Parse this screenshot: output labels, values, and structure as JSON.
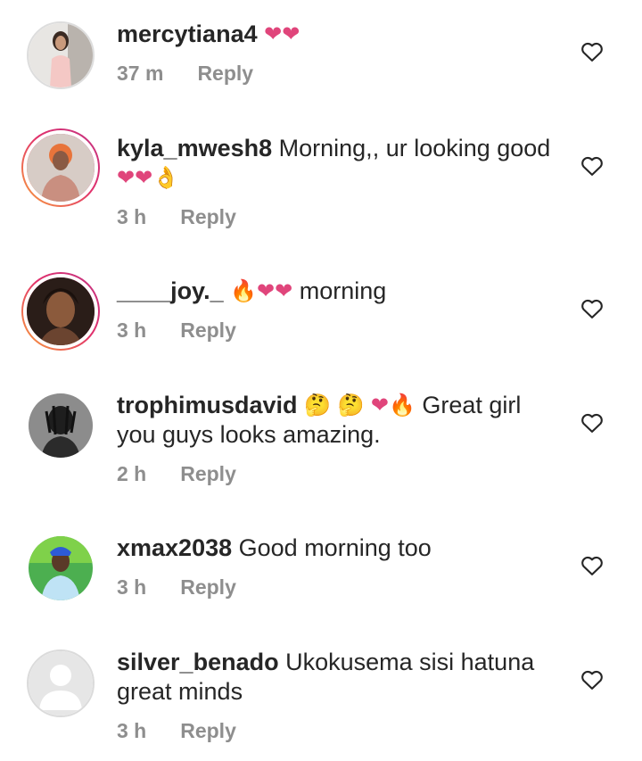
{
  "comments": [
    {
      "username": "mercytiana4",
      "text": "",
      "emoji_before": [
        "❤",
        "❤"
      ],
      "time": "37 m",
      "reply_label": "Reply"
    },
    {
      "username": "kyla_mwesh8",
      "text": "Morning,, ur looking good",
      "emoji_after": [
        "❤",
        "❤",
        "👌"
      ],
      "time": "3 h",
      "reply_label": "Reply"
    },
    {
      "username": "____joy._",
      "text": "morning",
      "emoji_before": [
        "🔥",
        "❤",
        "❤"
      ],
      "time": "3 h",
      "reply_label": "Reply"
    },
    {
      "username": "trophimusdavid",
      "text": "Great girl you guys looks amazing.",
      "emoji_before": [
        "🤔",
        "🤔",
        "❤",
        "🔥"
      ],
      "time": "2 h",
      "reply_label": "Reply"
    },
    {
      "username": "xmax2038",
      "text": "Good morning too",
      "time": "3 h",
      "reply_label": "Reply"
    },
    {
      "username": "silver_benado",
      "text": "Ukokusema sisi hatuna great minds",
      "time": "3 h",
      "reply_label": "Reply"
    }
  ],
  "icons": {
    "like": "heart-outline-icon",
    "avatar_placeholder": "default-avatar-icon"
  },
  "colors": {
    "text": "#262626",
    "meta": "#8e8e8e",
    "heart_emoji": "#e0457b",
    "story_ring_start": "#f9a23b",
    "story_ring_end": "#c13584"
  }
}
